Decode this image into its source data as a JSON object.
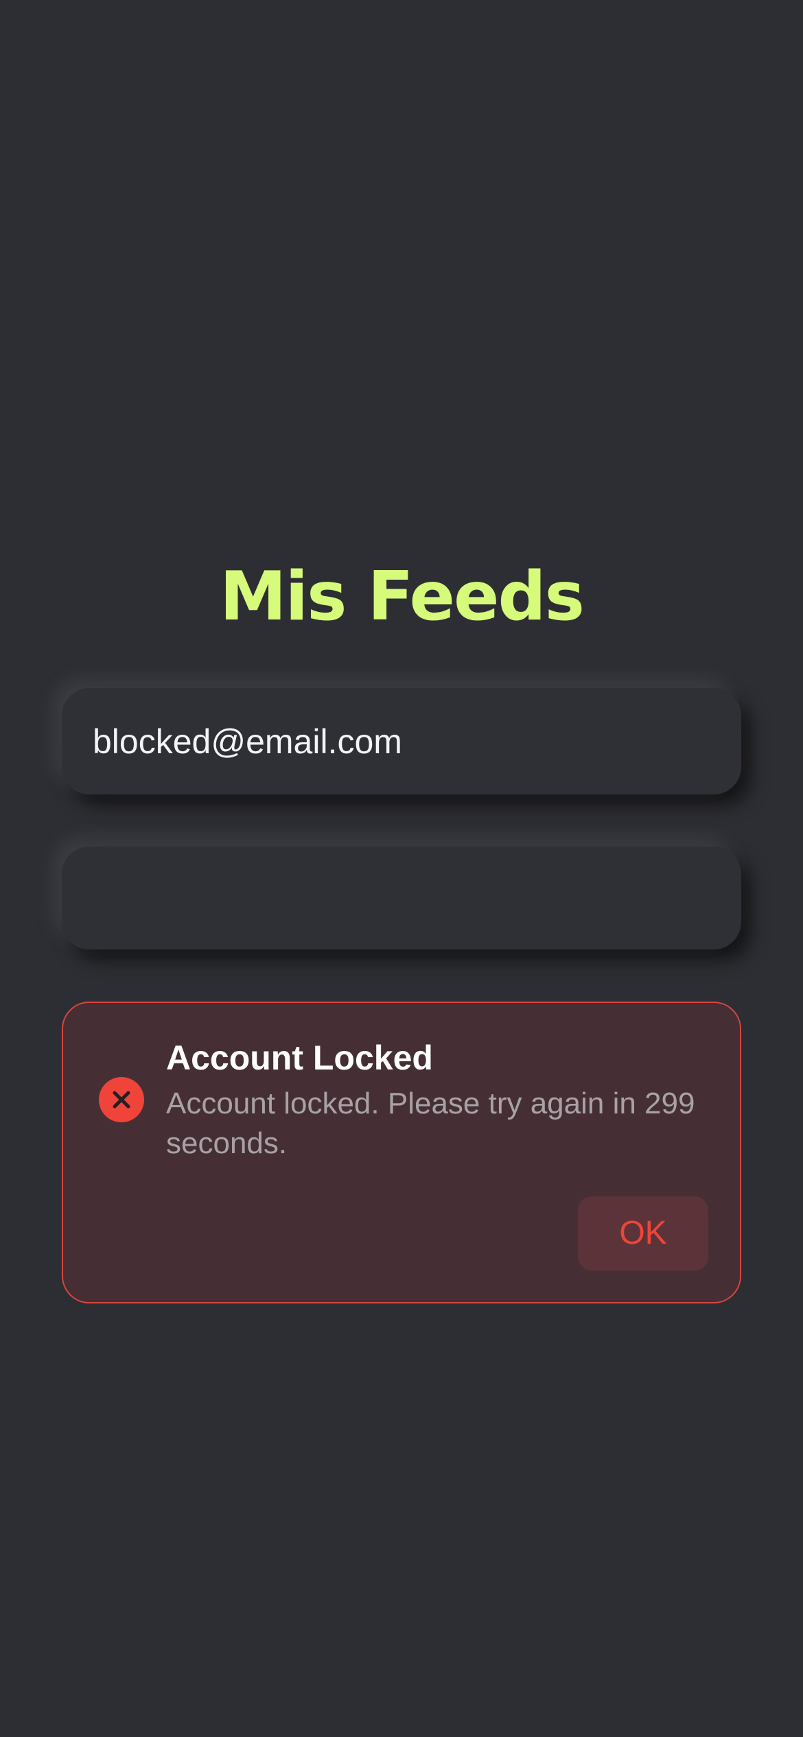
{
  "app": {
    "title": "Mis Feeds",
    "accent_color": "#d6fb7a",
    "background_color": "#2d2e33"
  },
  "form": {
    "email": {
      "value": "blocked@email.com",
      "placeholder": ""
    },
    "password": {
      "value": "",
      "placeholder": ""
    }
  },
  "alert": {
    "icon": "x-circle-icon",
    "title": "Account Locked",
    "message": "Account locked. Please try again in 299 seconds.",
    "ok_label": "OK",
    "error_color": "#f0443a"
  }
}
